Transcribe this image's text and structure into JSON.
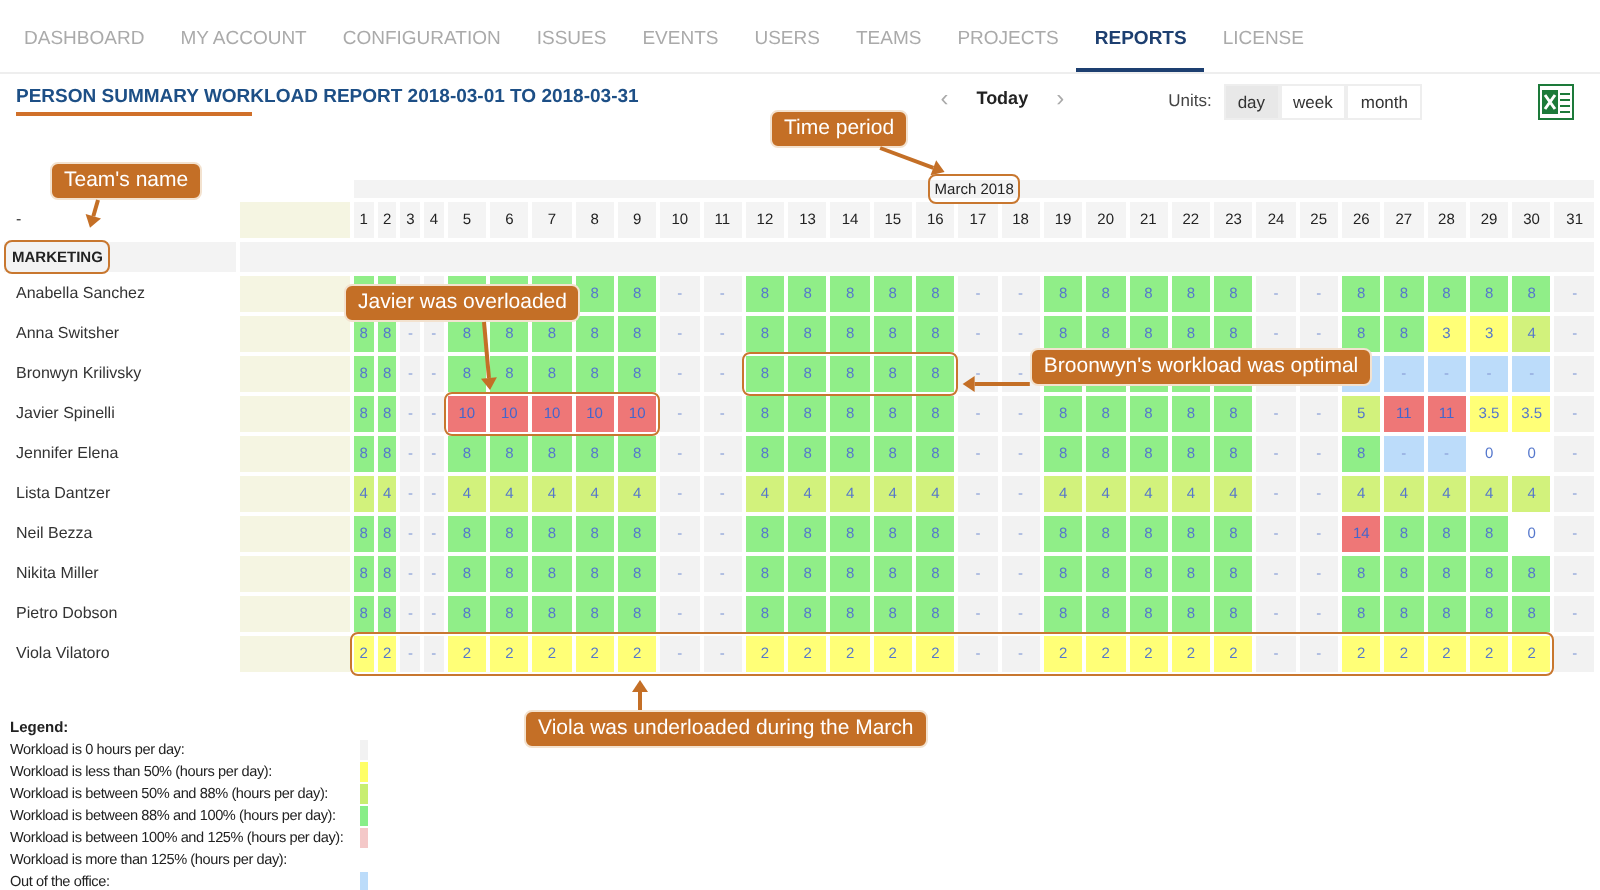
{
  "nav": [
    {
      "label": "DASHBOARD",
      "selected": false
    },
    {
      "label": "MY ACCOUNT",
      "selected": false
    },
    {
      "label": "CONFIGURATION",
      "selected": false
    },
    {
      "label": "ISSUES",
      "selected": false
    },
    {
      "label": "EVENTS",
      "selected": false
    },
    {
      "label": "USERS",
      "selected": false
    },
    {
      "label": "TEAMS",
      "selected": false
    },
    {
      "label": "PROJECTS",
      "selected": false
    },
    {
      "label": "REPORTS",
      "selected": true
    },
    {
      "label": "LICENSE",
      "selected": false
    }
  ],
  "title": "PERSON SUMMARY WORKLOAD REPORT 2018-03-01 TO 2018-03-31",
  "period_nav": {
    "prev": "‹",
    "today": "Today",
    "next": "›"
  },
  "units": {
    "label": "Units:",
    "options": [
      {
        "label": "day",
        "selected": true
      },
      {
        "label": "week",
        "selected": false
      },
      {
        "label": "month",
        "selected": false
      }
    ]
  },
  "table": {
    "month": "March 2018",
    "name_header": "-",
    "days": [
      "1",
      "2",
      "3",
      "4",
      "5",
      "6",
      "7",
      "8",
      "9",
      "10",
      "11",
      "12",
      "13",
      "14",
      "15",
      "16",
      "17",
      "18",
      "19",
      "20",
      "21",
      "22",
      "23",
      "24",
      "25",
      "26",
      "27",
      "28",
      "29",
      "30",
      "31"
    ],
    "team": "MARKETING",
    "people": [
      {
        "name": "Anabella Sanchez",
        "cells": [
          {
            "kind": "full"
          },
          {
            "kind": "full"
          },
          {
            "kind": "none"
          },
          {
            "kind": "none"
          },
          {
            "kind": "full"
          },
          {
            "kind": "full"
          },
          {
            "kind": "full"
          },
          {
            "text": "8",
            "kind": "full"
          },
          {
            "text": "8",
            "kind": "full"
          },
          {
            "text": "-",
            "kind": "none"
          },
          {
            "text": "-",
            "kind": "none"
          },
          {
            "text": "8",
            "kind": "full"
          },
          {
            "text": "8",
            "kind": "full"
          },
          {
            "text": "8",
            "kind": "full"
          },
          {
            "text": "8",
            "kind": "full"
          },
          {
            "text": "8",
            "kind": "full"
          },
          {
            "text": "-",
            "kind": "none"
          },
          {
            "text": "-",
            "kind": "none"
          },
          {
            "text": "8",
            "kind": "full"
          },
          {
            "text": "8",
            "kind": "full"
          },
          {
            "text": "8",
            "kind": "full"
          },
          {
            "text": "8",
            "kind": "full"
          },
          {
            "text": "8",
            "kind": "full"
          },
          {
            "text": "-",
            "kind": "none"
          },
          {
            "text": "-",
            "kind": "none"
          },
          {
            "text": "8",
            "kind": "full"
          },
          {
            "text": "8",
            "kind": "full"
          },
          {
            "text": "8",
            "kind": "full"
          },
          {
            "text": "8",
            "kind": "full"
          },
          {
            "text": "8",
            "kind": "full"
          },
          {
            "text": "-",
            "kind": "none"
          }
        ]
      },
      {
        "name": "Anna Switsher",
        "cells": [
          {
            "text": "8",
            "kind": "full"
          },
          {
            "text": "8",
            "kind": "full"
          },
          {
            "text": "-",
            "kind": "none"
          },
          {
            "text": "-",
            "kind": "none"
          },
          {
            "text": "8",
            "kind": "full"
          },
          {
            "text": "8",
            "kind": "full"
          },
          {
            "text": "8",
            "kind": "full"
          },
          {
            "text": "8",
            "kind": "full"
          },
          {
            "text": "8",
            "kind": "full"
          },
          {
            "text": "-",
            "kind": "none"
          },
          {
            "text": "-",
            "kind": "none"
          },
          {
            "text": "8",
            "kind": "full"
          },
          {
            "text": "8",
            "kind": "full"
          },
          {
            "text": "8",
            "kind": "full"
          },
          {
            "text": "8",
            "kind": "full"
          },
          {
            "text": "8",
            "kind": "full"
          },
          {
            "text": "-",
            "kind": "none"
          },
          {
            "text": "-",
            "kind": "none"
          },
          {
            "text": "8",
            "kind": "full"
          },
          {
            "text": "8",
            "kind": "full"
          },
          {
            "text": "8",
            "kind": "full"
          },
          {
            "text": "8",
            "kind": "full"
          },
          {
            "text": "8",
            "kind": "full"
          },
          {
            "text": "-",
            "kind": "none"
          },
          {
            "text": "-",
            "kind": "none"
          },
          {
            "text": "8",
            "kind": "full"
          },
          {
            "text": "8",
            "kind": "full"
          },
          {
            "text": "3",
            "kind": "under"
          },
          {
            "text": "3",
            "kind": "under"
          },
          {
            "text": "4",
            "kind": "partial"
          },
          {
            "text": "-",
            "kind": "none"
          }
        ]
      },
      {
        "name": "Bronwyn Krilivsky",
        "cells": [
          {
            "text": "8",
            "kind": "full"
          },
          {
            "text": "8",
            "kind": "full"
          },
          {
            "text": "-",
            "kind": "none"
          },
          {
            "text": "-",
            "kind": "none"
          },
          {
            "text": "8",
            "kind": "full"
          },
          {
            "text": "8",
            "kind": "full"
          },
          {
            "text": "8",
            "kind": "full"
          },
          {
            "text": "8",
            "kind": "full"
          },
          {
            "text": "8",
            "kind": "full"
          },
          {
            "text": "-",
            "kind": "none"
          },
          {
            "text": "-",
            "kind": "none"
          },
          {
            "text": "8",
            "kind": "full"
          },
          {
            "text": "8",
            "kind": "full"
          },
          {
            "text": "8",
            "kind": "full"
          },
          {
            "text": "8",
            "kind": "full"
          },
          {
            "text": "8",
            "kind": "full"
          },
          {
            "text": "-",
            "kind": "none"
          },
          {
            "text": "-",
            "kind": "none"
          },
          {
            "kind": "full"
          },
          {
            "kind": "full"
          },
          {
            "kind": "full"
          },
          {
            "kind": "full"
          },
          {
            "kind": "full"
          },
          {
            "kind": "none"
          },
          {
            "kind": "none"
          },
          {
            "kind": "out"
          },
          {
            "text": "-",
            "kind": "out"
          },
          {
            "text": "-",
            "kind": "out"
          },
          {
            "text": "-",
            "kind": "out"
          },
          {
            "text": "-",
            "kind": "out"
          },
          {
            "text": "-",
            "kind": "none"
          }
        ]
      },
      {
        "name": "Javier Spinelli",
        "cells": [
          {
            "text": "8",
            "kind": "full"
          },
          {
            "text": "8",
            "kind": "full"
          },
          {
            "text": "-",
            "kind": "none"
          },
          {
            "text": "-",
            "kind": "none"
          },
          {
            "text": "10",
            "kind": "over"
          },
          {
            "text": "10",
            "kind": "over"
          },
          {
            "text": "10",
            "kind": "over"
          },
          {
            "text": "10",
            "kind": "over"
          },
          {
            "text": "10",
            "kind": "over"
          },
          {
            "text": "-",
            "kind": "none"
          },
          {
            "text": "-",
            "kind": "none"
          },
          {
            "text": "8",
            "kind": "full"
          },
          {
            "text": "8",
            "kind": "full"
          },
          {
            "text": "8",
            "kind": "full"
          },
          {
            "text": "8",
            "kind": "full"
          },
          {
            "text": "8",
            "kind": "full"
          },
          {
            "text": "-",
            "kind": "none"
          },
          {
            "text": "-",
            "kind": "none"
          },
          {
            "text": "8",
            "kind": "full"
          },
          {
            "text": "8",
            "kind": "full"
          },
          {
            "text": "8",
            "kind": "full"
          },
          {
            "text": "8",
            "kind": "full"
          },
          {
            "text": "8",
            "kind": "full"
          },
          {
            "text": "-",
            "kind": "none"
          },
          {
            "text": "-",
            "kind": "none"
          },
          {
            "text": "5",
            "kind": "partial"
          },
          {
            "text": "11",
            "kind": "over"
          },
          {
            "text": "11",
            "kind": "over"
          },
          {
            "text": "3.5",
            "kind": "under"
          },
          {
            "text": "3.5",
            "kind": "under"
          },
          {
            "text": "-",
            "kind": "none"
          }
        ]
      },
      {
        "name": "Jennifer Elena",
        "cells": [
          {
            "text": "8",
            "kind": "full"
          },
          {
            "text": "8",
            "kind": "full"
          },
          {
            "text": "-",
            "kind": "none"
          },
          {
            "text": "-",
            "kind": "none"
          },
          {
            "text": "8",
            "kind": "full"
          },
          {
            "text": "8",
            "kind": "full"
          },
          {
            "text": "8",
            "kind": "full"
          },
          {
            "text": "8",
            "kind": "full"
          },
          {
            "text": "8",
            "kind": "full"
          },
          {
            "text": "-",
            "kind": "none"
          },
          {
            "text": "-",
            "kind": "none"
          },
          {
            "text": "8",
            "kind": "full"
          },
          {
            "text": "8",
            "kind": "full"
          },
          {
            "text": "8",
            "kind": "full"
          },
          {
            "text": "8",
            "kind": "full"
          },
          {
            "text": "8",
            "kind": "full"
          },
          {
            "text": "-",
            "kind": "none"
          },
          {
            "text": "-",
            "kind": "none"
          },
          {
            "text": "8",
            "kind": "full"
          },
          {
            "text": "8",
            "kind": "full"
          },
          {
            "text": "8",
            "kind": "full"
          },
          {
            "text": "8",
            "kind": "full"
          },
          {
            "text": "8",
            "kind": "full"
          },
          {
            "text": "-",
            "kind": "none"
          },
          {
            "text": "-",
            "kind": "none"
          },
          {
            "text": "8",
            "kind": "full"
          },
          {
            "text": "-",
            "kind": "out"
          },
          {
            "text": "-",
            "kind": "out"
          },
          {
            "text": "0",
            "kind": "zero"
          },
          {
            "text": "0",
            "kind": "zero"
          },
          {
            "text": "-",
            "kind": "none"
          }
        ]
      },
      {
        "name": "Lista Dantzer",
        "cells": [
          {
            "text": "4",
            "kind": "partial"
          },
          {
            "text": "4",
            "kind": "partial"
          },
          {
            "text": "-",
            "kind": "none"
          },
          {
            "text": "-",
            "kind": "none"
          },
          {
            "text": "4",
            "kind": "partial"
          },
          {
            "text": "4",
            "kind": "partial"
          },
          {
            "text": "4",
            "kind": "partial"
          },
          {
            "text": "4",
            "kind": "partial"
          },
          {
            "text": "4",
            "kind": "partial"
          },
          {
            "text": "-",
            "kind": "none"
          },
          {
            "text": "-",
            "kind": "none"
          },
          {
            "text": "4",
            "kind": "partial"
          },
          {
            "text": "4",
            "kind": "partial"
          },
          {
            "text": "4",
            "kind": "partial"
          },
          {
            "text": "4",
            "kind": "partial"
          },
          {
            "text": "4",
            "kind": "partial"
          },
          {
            "text": "-",
            "kind": "none"
          },
          {
            "text": "-",
            "kind": "none"
          },
          {
            "text": "4",
            "kind": "partial"
          },
          {
            "text": "4",
            "kind": "partial"
          },
          {
            "text": "4",
            "kind": "partial"
          },
          {
            "text": "4",
            "kind": "partial"
          },
          {
            "text": "4",
            "kind": "partial"
          },
          {
            "text": "-",
            "kind": "none"
          },
          {
            "text": "-",
            "kind": "none"
          },
          {
            "text": "4",
            "kind": "partial"
          },
          {
            "text": "4",
            "kind": "partial"
          },
          {
            "text": "4",
            "kind": "partial"
          },
          {
            "text": "4",
            "kind": "partial"
          },
          {
            "text": "4",
            "kind": "partial"
          },
          {
            "text": "-",
            "kind": "none"
          }
        ]
      },
      {
        "name": "Neil Bezza",
        "cells": [
          {
            "text": "8",
            "kind": "full"
          },
          {
            "text": "8",
            "kind": "full"
          },
          {
            "text": "-",
            "kind": "none"
          },
          {
            "text": "-",
            "kind": "none"
          },
          {
            "text": "8",
            "kind": "full"
          },
          {
            "text": "8",
            "kind": "full"
          },
          {
            "text": "8",
            "kind": "full"
          },
          {
            "text": "8",
            "kind": "full"
          },
          {
            "text": "8",
            "kind": "full"
          },
          {
            "text": "-",
            "kind": "none"
          },
          {
            "text": "-",
            "kind": "none"
          },
          {
            "text": "8",
            "kind": "full"
          },
          {
            "text": "8",
            "kind": "full"
          },
          {
            "text": "8",
            "kind": "full"
          },
          {
            "text": "8",
            "kind": "full"
          },
          {
            "text": "8",
            "kind": "full"
          },
          {
            "text": "-",
            "kind": "none"
          },
          {
            "text": "-",
            "kind": "none"
          },
          {
            "text": "8",
            "kind": "full"
          },
          {
            "text": "8",
            "kind": "full"
          },
          {
            "text": "8",
            "kind": "full"
          },
          {
            "text": "8",
            "kind": "full"
          },
          {
            "text": "8",
            "kind": "full"
          },
          {
            "text": "-",
            "kind": "none"
          },
          {
            "text": "-",
            "kind": "none"
          },
          {
            "text": "14",
            "kind": "over"
          },
          {
            "text": "8",
            "kind": "full"
          },
          {
            "text": "8",
            "kind": "full"
          },
          {
            "text": "8",
            "kind": "full"
          },
          {
            "text": "0",
            "kind": "zero"
          },
          {
            "text": "-",
            "kind": "none"
          }
        ]
      },
      {
        "name": "Nikita Miller",
        "cells": [
          {
            "text": "8",
            "kind": "full"
          },
          {
            "text": "8",
            "kind": "full"
          },
          {
            "text": "-",
            "kind": "none"
          },
          {
            "text": "-",
            "kind": "none"
          },
          {
            "text": "8",
            "kind": "full"
          },
          {
            "text": "8",
            "kind": "full"
          },
          {
            "text": "8",
            "kind": "full"
          },
          {
            "text": "8",
            "kind": "full"
          },
          {
            "text": "8",
            "kind": "full"
          },
          {
            "text": "-",
            "kind": "none"
          },
          {
            "text": "-",
            "kind": "none"
          },
          {
            "text": "8",
            "kind": "full"
          },
          {
            "text": "8",
            "kind": "full"
          },
          {
            "text": "8",
            "kind": "full"
          },
          {
            "text": "8",
            "kind": "full"
          },
          {
            "text": "8",
            "kind": "full"
          },
          {
            "text": "-",
            "kind": "none"
          },
          {
            "text": "-",
            "kind": "none"
          },
          {
            "text": "8",
            "kind": "full"
          },
          {
            "text": "8",
            "kind": "full"
          },
          {
            "text": "8",
            "kind": "full"
          },
          {
            "text": "8",
            "kind": "full"
          },
          {
            "text": "8",
            "kind": "full"
          },
          {
            "text": "-",
            "kind": "none"
          },
          {
            "text": "-",
            "kind": "none"
          },
          {
            "text": "8",
            "kind": "full"
          },
          {
            "text": "8",
            "kind": "full"
          },
          {
            "text": "8",
            "kind": "full"
          },
          {
            "text": "8",
            "kind": "full"
          },
          {
            "text": "8",
            "kind": "full"
          },
          {
            "text": "-",
            "kind": "none"
          }
        ]
      },
      {
        "name": "Pietro Dobson",
        "cells": [
          {
            "text": "8",
            "kind": "full"
          },
          {
            "text": "8",
            "kind": "full"
          },
          {
            "text": "-",
            "kind": "none"
          },
          {
            "text": "-",
            "kind": "none"
          },
          {
            "text": "8",
            "kind": "full"
          },
          {
            "text": "8",
            "kind": "full"
          },
          {
            "text": "8",
            "kind": "full"
          },
          {
            "text": "8",
            "kind": "full"
          },
          {
            "text": "8",
            "kind": "full"
          },
          {
            "text": "-",
            "kind": "none"
          },
          {
            "text": "-",
            "kind": "none"
          },
          {
            "text": "8",
            "kind": "full"
          },
          {
            "text": "8",
            "kind": "full"
          },
          {
            "text": "8",
            "kind": "full"
          },
          {
            "text": "8",
            "kind": "full"
          },
          {
            "text": "8",
            "kind": "full"
          },
          {
            "text": "-",
            "kind": "none"
          },
          {
            "text": "-",
            "kind": "none"
          },
          {
            "text": "8",
            "kind": "full"
          },
          {
            "text": "8",
            "kind": "full"
          },
          {
            "text": "8",
            "kind": "full"
          },
          {
            "text": "8",
            "kind": "full"
          },
          {
            "text": "8",
            "kind": "full"
          },
          {
            "text": "-",
            "kind": "none"
          },
          {
            "text": "-",
            "kind": "none"
          },
          {
            "text": "8",
            "kind": "full"
          },
          {
            "text": "8",
            "kind": "full"
          },
          {
            "text": "8",
            "kind": "full"
          },
          {
            "text": "8",
            "kind": "full"
          },
          {
            "text": "8",
            "kind": "full"
          },
          {
            "text": "-",
            "kind": "none"
          }
        ]
      },
      {
        "name": "Viola Vilatoro",
        "cells": [
          {
            "text": "2",
            "kind": "under"
          },
          {
            "text": "2",
            "kind": "under"
          },
          {
            "text": "-",
            "kind": "none"
          },
          {
            "text": "-",
            "kind": "none"
          },
          {
            "text": "2",
            "kind": "under"
          },
          {
            "text": "2",
            "kind": "under"
          },
          {
            "text": "2",
            "kind": "under"
          },
          {
            "text": "2",
            "kind": "under"
          },
          {
            "text": "2",
            "kind": "under"
          },
          {
            "text": "-",
            "kind": "none"
          },
          {
            "text": "-",
            "kind": "none"
          },
          {
            "text": "2",
            "kind": "under"
          },
          {
            "text": "2",
            "kind": "under"
          },
          {
            "text": "2",
            "kind": "under"
          },
          {
            "text": "2",
            "kind": "under"
          },
          {
            "text": "2",
            "kind": "under"
          },
          {
            "text": "-",
            "kind": "none"
          },
          {
            "text": "-",
            "kind": "none"
          },
          {
            "text": "2",
            "kind": "under"
          },
          {
            "text": "2",
            "kind": "under"
          },
          {
            "text": "2",
            "kind": "under"
          },
          {
            "text": "2",
            "kind": "under"
          },
          {
            "text": "2",
            "kind": "under"
          },
          {
            "text": "-",
            "kind": "none"
          },
          {
            "text": "-",
            "kind": "none"
          },
          {
            "text": "2",
            "kind": "under"
          },
          {
            "text": "2",
            "kind": "under"
          },
          {
            "text": "2",
            "kind": "under"
          },
          {
            "text": "2",
            "kind": "under"
          },
          {
            "text": "2",
            "kind": "under"
          },
          {
            "text": "-",
            "kind": "none"
          }
        ]
      }
    ]
  },
  "legend": {
    "title": "Legend:",
    "items": [
      {
        "label": "Workload is 0 hours per day:",
        "color": "#f2f2f2"
      },
      {
        "label": "Workload is less than 50% (hours per day):",
        "color": "#ffff66"
      },
      {
        "label": "Workload is between 50% and 88% (hours per day):",
        "color": "#c8ee70"
      },
      {
        "label": "Workload is between 88% and 100% (hours per day):",
        "color": "#88ee88"
      },
      {
        "label": "Workload is between 100% and 125% (hours per day):",
        "color": "#f4c8c8"
      },
      {
        "label": "Workload is more than 125% (hours per day):"
      },
      {
        "label": "Out of the office:",
        "color": "#bcdcfa"
      }
    ]
  },
  "annotations": [
    "Time period",
    "Team's name",
    "Javier was overloaded",
    "Broonwyn's workload was optimal",
    "Viola was underloaded during the March"
  ]
}
